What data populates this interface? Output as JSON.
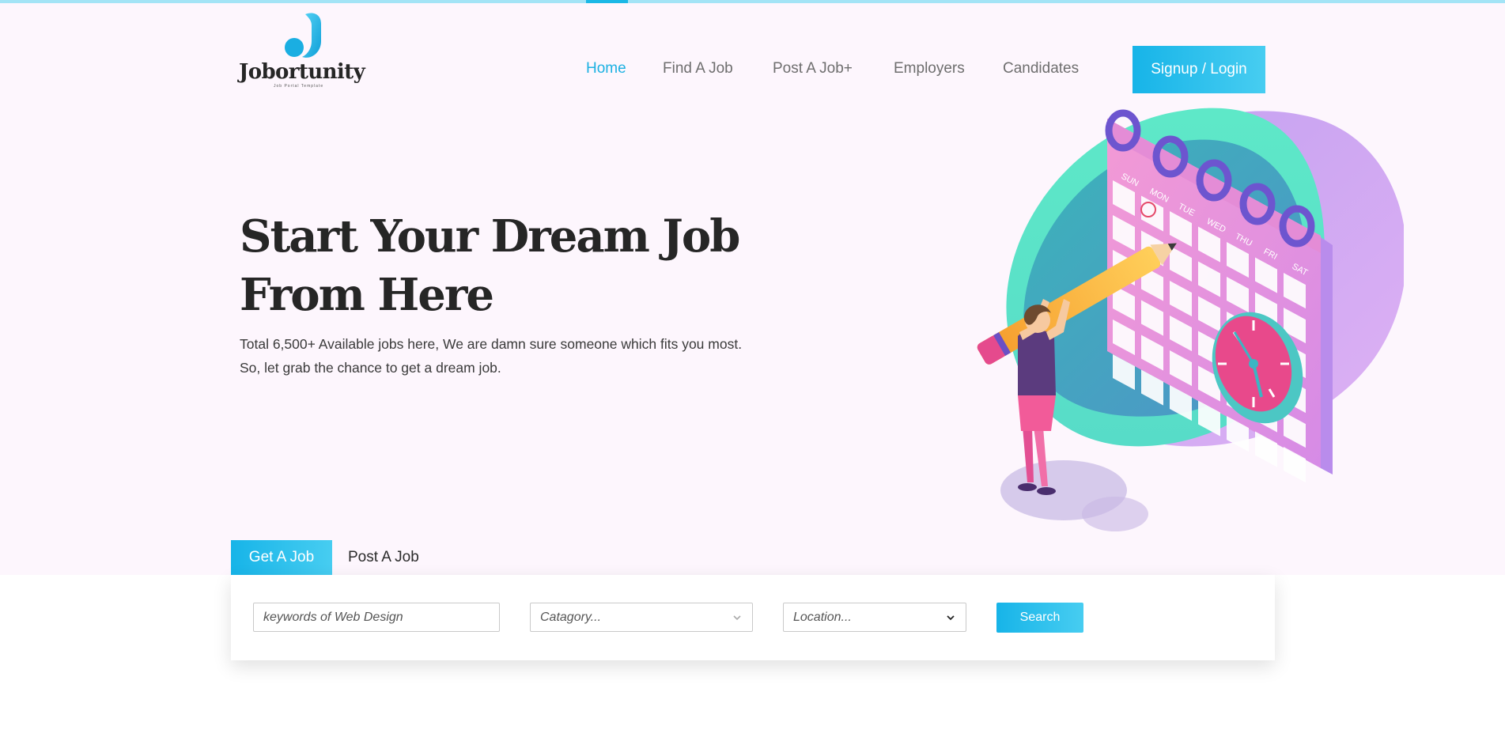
{
  "colors": {
    "accent": "#1bb8e6",
    "hero_background": "#fdf6fd",
    "text_dark": "#262626",
    "nav_text": "#6e6e6e"
  },
  "logo": {
    "name": "Jobortunity",
    "tagline": "Job Portal Template"
  },
  "nav": {
    "items": [
      {
        "label": "Home",
        "active": true
      },
      {
        "label": "Find A Job",
        "active": false
      },
      {
        "label": "Post A Job+",
        "active": false
      },
      {
        "label": "Employers",
        "active": false
      },
      {
        "label": "Candidates",
        "active": false
      }
    ],
    "signup_label": "Signup / Login"
  },
  "hero": {
    "title": "Start Your Dream Job From Here",
    "subtitle": "Total 6,500+ Available jobs here, We are damn sure someone which fits you most. So, let grab the chance to get a dream job.",
    "calendar_days": [
      "SUN",
      "MON",
      "TUE",
      "WED",
      "THU",
      "FRI",
      "SAT"
    ]
  },
  "tabs": {
    "get_job": "Get A Job",
    "post_job": "Post A Job"
  },
  "search": {
    "keywords_placeholder": "keywords of Web Design",
    "category_placeholder": "Catagory...",
    "location_placeholder": "Location...",
    "button_label": "Search"
  }
}
